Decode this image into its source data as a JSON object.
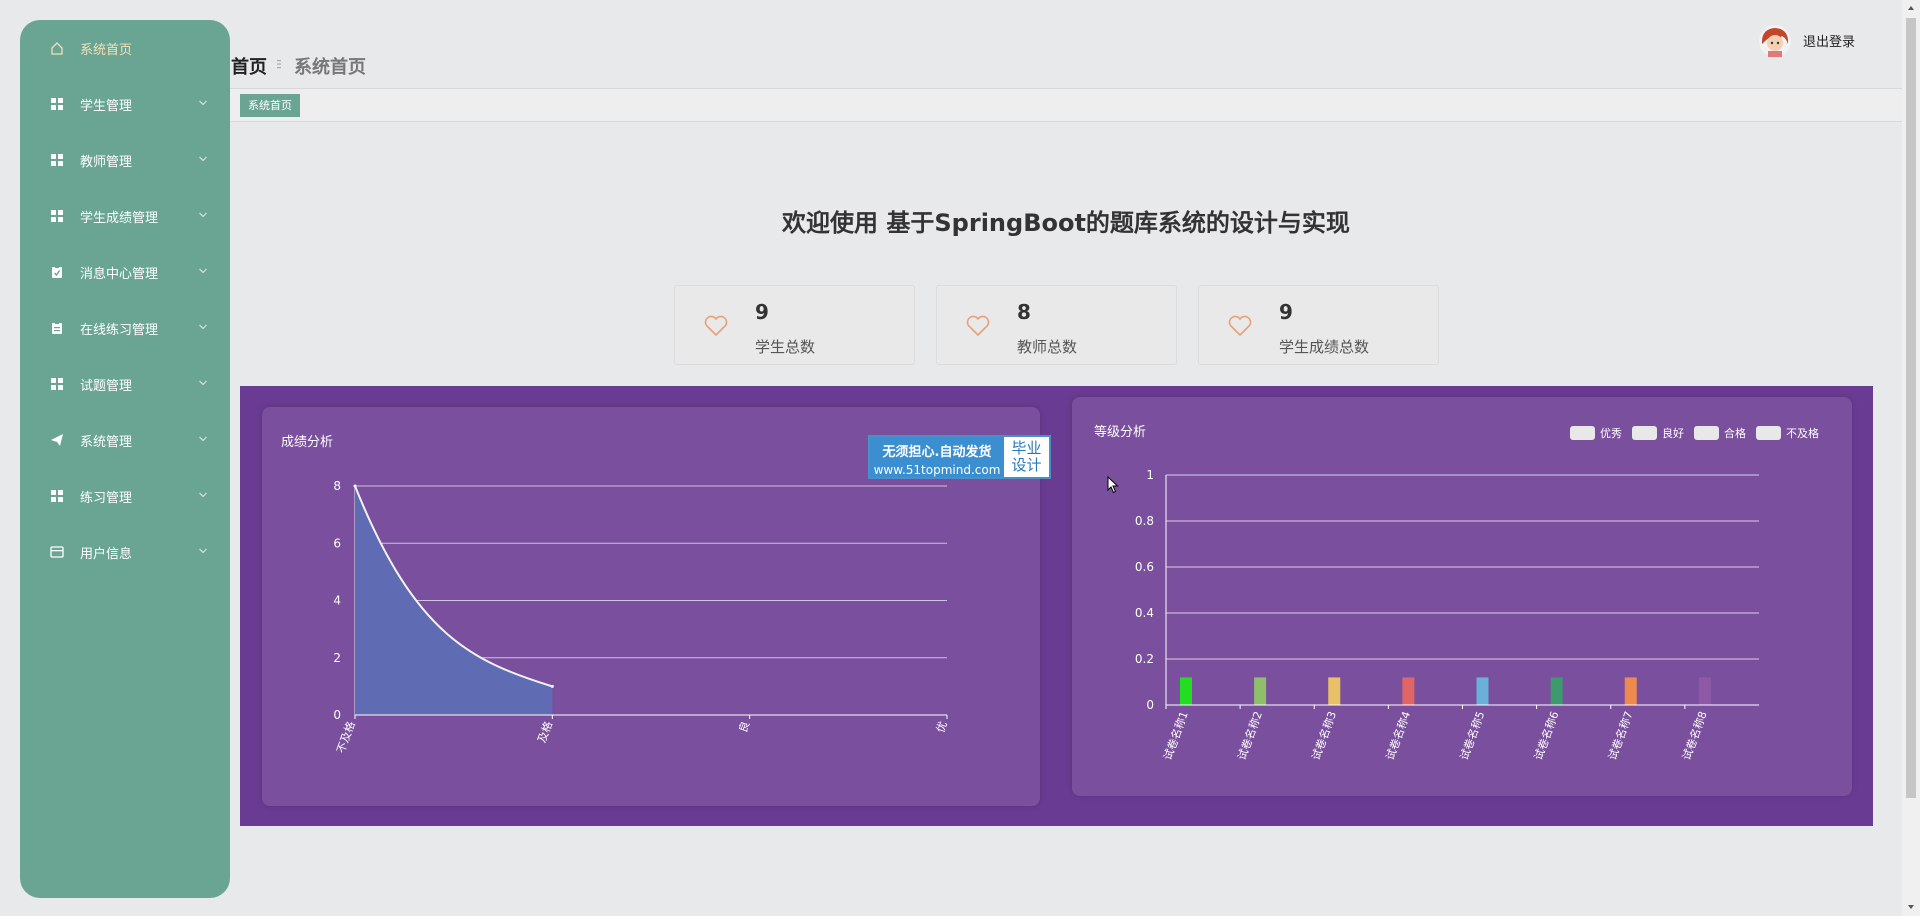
{
  "sidebar": {
    "items": [
      {
        "label": "系统首页",
        "icon": "home-icon",
        "active": true,
        "chevron": false
      },
      {
        "label": "学生管理",
        "icon": "grid-icon",
        "active": false,
        "chevron": true
      },
      {
        "label": "教师管理",
        "icon": "grid-icon",
        "active": false,
        "chevron": true
      },
      {
        "label": "学生成绩管理",
        "icon": "grid-icon",
        "active": false,
        "chevron": true
      },
      {
        "label": "消息中心管理",
        "icon": "clipboard-check-icon",
        "active": false,
        "chevron": true
      },
      {
        "label": "在线练习管理",
        "icon": "clipboard-icon",
        "active": false,
        "chevron": true
      },
      {
        "label": "试题管理",
        "icon": "grid-icon",
        "active": false,
        "chevron": true
      },
      {
        "label": "系统管理",
        "icon": "send-icon",
        "active": false,
        "chevron": true
      },
      {
        "label": "练习管理",
        "icon": "grid-icon",
        "active": false,
        "chevron": true
      },
      {
        "label": "用户信息",
        "icon": "card-icon",
        "active": false,
        "chevron": true
      }
    ]
  },
  "header": {
    "breadcrumb_home": "首页",
    "breadcrumb_current": "系统首页",
    "logout_label": "退出登录"
  },
  "tabs": {
    "active_tab": "系统首页"
  },
  "welcome": {
    "title": "欢迎使用 基于SpringBoot的题库系统的设计与实现"
  },
  "stats": [
    {
      "value": "9",
      "label": "学生总数"
    },
    {
      "value": "8",
      "label": "教师总数"
    },
    {
      "value": "9",
      "label": "学生成绩总数"
    }
  ],
  "watermark": {
    "line1": "无须担心.自动发货",
    "line2": "www.51topmind.com",
    "badge1": "毕业",
    "badge2": "设计"
  },
  "colors": {
    "sidebar": "#6aa594",
    "accent_purple": "#6a3b92",
    "panel_purple": "#7a4f9d",
    "heart": "#e8a27a"
  },
  "chart_data": [
    {
      "type": "area",
      "title": "成绩分析",
      "categories": [
        "不及格",
        "及格",
        "良",
        "优"
      ],
      "series": [
        {
          "values": [
            8,
            1
          ]
        }
      ],
      "ylim": [
        0,
        8
      ],
      "yticks": [
        0,
        2,
        4,
        6,
        8
      ],
      "grid": true
    },
    {
      "type": "bar",
      "title": "等级分析",
      "categories": [
        "试卷名称1",
        "试卷名称2",
        "试卷名称3",
        "试卷名称4",
        "试卷名称5",
        "试卷名称6",
        "试卷名称7",
        "试卷名称8"
      ],
      "values": [
        0.12,
        0.12,
        0.12,
        0.12,
        0.12,
        0.12,
        0.12,
        0.12
      ],
      "bar_colors": [
        "#22dd22",
        "#8fbf6a",
        "#e8c066",
        "#e06666",
        "#6ab0d8",
        "#3c9a6e",
        "#ef8a4e",
        "#8e5aa8"
      ],
      "legend": [
        "优秀",
        "良好",
        "合格",
        "不及格"
      ],
      "legend_position": "top-right",
      "ylim": [
        0,
        1
      ],
      "yticks": [
        "0",
        "0.2",
        "0.4",
        "0.6",
        "0.8",
        "1"
      ],
      "grid": true
    }
  ]
}
